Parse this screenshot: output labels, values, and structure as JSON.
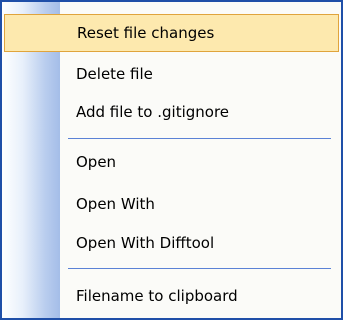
{
  "context_menu": {
    "items": [
      {
        "label": "Reset file changes",
        "highlighted": true
      },
      {
        "label": "Delete file"
      },
      {
        "label": "Add file to .gitignore"
      },
      {
        "label": "Open"
      },
      {
        "label": "Open With"
      },
      {
        "label": "Open With Difftool"
      },
      {
        "label": "Filename to clipboard"
      }
    ],
    "colors": {
      "border": "#1f4fa8",
      "highlight_fill": "#fde9ae",
      "highlight_border": "#e0a43c",
      "separator": "#5b82d6",
      "gutter": "#a4bde8"
    }
  }
}
